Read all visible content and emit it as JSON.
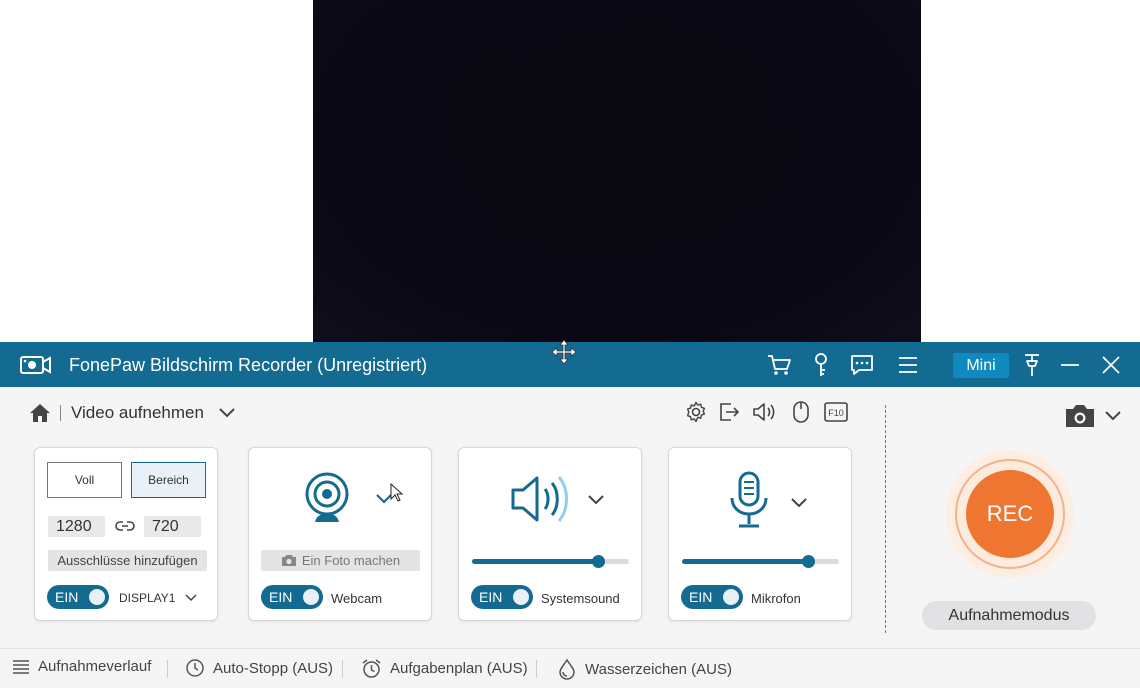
{
  "window": {
    "title": "FonePaw Bildschirm Recorder (Unregistriert)",
    "mini_label": "Mini"
  },
  "toolbar": {
    "mode_label": "Video aufnehmen"
  },
  "display_card": {
    "full_label": "Voll",
    "region_label": "Bereich",
    "width": "1280",
    "height": "720",
    "exclusions_label": "Ausschlüsse hinzufügen",
    "toggle_label": "EIN",
    "display_name": "DISPLAY1"
  },
  "webcam_card": {
    "photo_label": "Ein Foto machen",
    "toggle_label": "EIN",
    "name": "Webcam"
  },
  "system_card": {
    "volume": 0.8,
    "toggle_label": "EIN",
    "name": "Systemsound"
  },
  "mic_card": {
    "volume": 0.8,
    "toggle_label": "EIN",
    "name": "Mikrofon"
  },
  "record": {
    "rec_label": "REC",
    "mode_label": "Aufnahmemodus"
  },
  "footer": {
    "history": "Aufnahmeverlauf",
    "auto_stop": "Auto-Stopp (AUS)",
    "schedule": "Aufgabenplan (AUS)",
    "watermark": "Wasserzeichen (AUS)"
  },
  "colors": {
    "accent": "#146b91",
    "rec": "#ef7630"
  }
}
